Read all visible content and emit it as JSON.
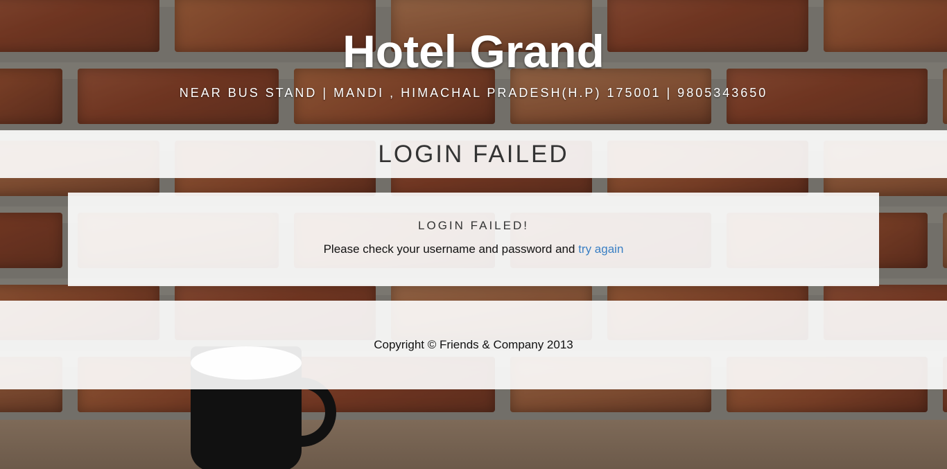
{
  "header": {
    "brand": "Hotel Grand",
    "address": "NEAR BUS STAND | MANDI , HIMACHAL PRADESH(H.P) 175001 | 9805343650"
  },
  "title_band": {
    "title": "LOGIN FAILED"
  },
  "message": {
    "heading": "LOGIN FAILED!",
    "text": "Please check your username and password and",
    "link_label": "try again"
  },
  "footer": {
    "copyright": "Copyright © Friends & Company 2013"
  },
  "colors": {
    "link": "#3a7fc4",
    "panel": "rgba(255,255,255,0.9)",
    "heading_text": "#333333"
  }
}
